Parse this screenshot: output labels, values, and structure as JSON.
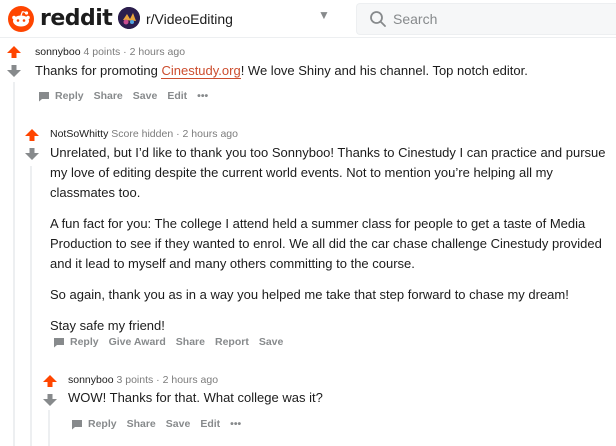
{
  "header": {
    "wordmark": "reddit",
    "subreddit": "r/VideoEditing",
    "search": {
      "placeholder": "Search"
    }
  },
  "comments": [
    {
      "author": "sonnyboo",
      "score": "4 points",
      "time": "2 hours ago",
      "text_before": "Thanks for promoting ",
      "link": "Cinestudy.org",
      "text_after": "! We love Shiny and his channel. Top notch editor.",
      "actions": [
        "Reply",
        "Share",
        "Save",
        "Edit",
        "•••"
      ]
    },
    {
      "author": "NotSoWhitty",
      "score": "Score hidden",
      "time": "2 hours ago",
      "paragraphs": [
        "Unrelated, but I’d like to thank you too Sonnyboo! Thanks to Cinestudy I can practice and pursue my love of editing despite the current world events. Not to mention you’re helping all my classmates too.",
        "A fun fact for you: The college I attend held a summer class for people to get a taste of Media Production to see if they wanted to enrol. We all did the car chase challenge Cinestudy provided and it lead to myself and many others committing to the course.",
        "So again, thank you as in a way you helped me take that step forward to chase my dream!",
        "Stay safe my friend!"
      ],
      "actions": [
        "Reply",
        "Give Award",
        "Share",
        "Report",
        "Save"
      ]
    },
    {
      "author": "sonnyboo",
      "score": "3 points",
      "time": "2 hours ago",
      "text": "WOW! Thanks for that. What college was it?",
      "actions": [
        "Reply",
        "Share",
        "Save",
        "Edit",
        "•••"
      ]
    }
  ],
  "separator": "·",
  "colors": {
    "accent": "#ff4500",
    "upvote": "#ff4500",
    "downvote_idle": "#878a8c",
    "link": "#cc4d2e"
  }
}
